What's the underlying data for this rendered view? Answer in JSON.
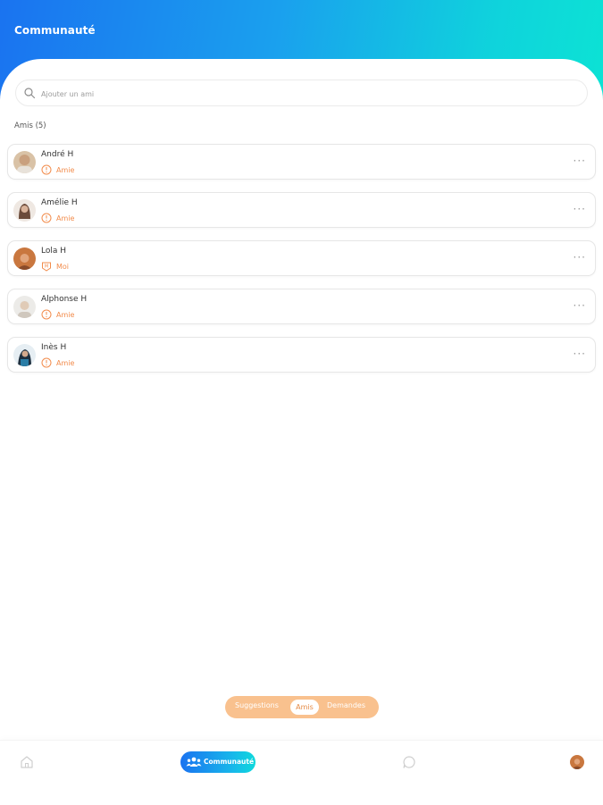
{
  "header": {
    "title": "Communauté"
  },
  "search": {
    "placeholder": "Ajouter un ami",
    "icon": "search-icon"
  },
  "section": {
    "title": "Amis (5)"
  },
  "friends": [
    {
      "name": "André  H",
      "status": "Amie",
      "status_icon": "clock-icon"
    },
    {
      "name": "Amélie H",
      "status": "Amie",
      "status_icon": "clock-icon"
    },
    {
      "name": "Lola  H",
      "status": "Moi",
      "status_icon": "user-badge-icon"
    },
    {
      "name": "Alphonse  H",
      "status": "Amie",
      "status_icon": "clock-icon"
    },
    {
      "name": "Inès H",
      "status": "Amie",
      "status_icon": "clock-icon"
    }
  ],
  "more_label": "···",
  "segments": {
    "left": "Suggestions",
    "active": "Amis",
    "right": "Demandes"
  },
  "tabbar": {
    "home_icon": "home-icon",
    "active_label": "Communauté",
    "active_icon": "community-icon",
    "chat_icon": "chat-icon",
    "profile_icon": "avatar"
  },
  "colors": {
    "header_gradient_start": "#1a73f0",
    "header_gradient_end": "#0ce3d4",
    "status_orange": "#f28c4c",
    "segment_bg": "#f9c18e"
  }
}
